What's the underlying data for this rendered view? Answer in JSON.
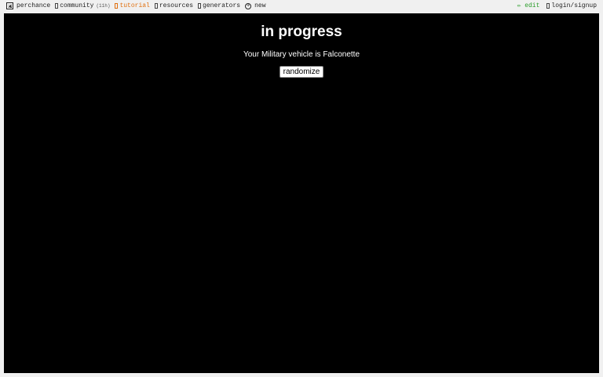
{
  "nav": {
    "left": [
      {
        "id": "perchance",
        "label": "perchance",
        "icon": "die-icon"
      },
      {
        "id": "community",
        "label": "community",
        "badge": "(11h)",
        "icon": "chat-icon"
      },
      {
        "id": "tutorial",
        "label": "tutorial",
        "icon": "book-icon",
        "color": "#e07010"
      },
      {
        "id": "resources",
        "label": "resources",
        "icon": "book-icon"
      },
      {
        "id": "generators",
        "label": "generators",
        "icon": "list-icon"
      },
      {
        "id": "new",
        "label": "new",
        "icon": "plus-circle-icon"
      }
    ],
    "right": [
      {
        "id": "edit",
        "label": "edit",
        "prefix": "✏",
        "icon": "pencil-icon",
        "color": "#2c9e2c"
      },
      {
        "id": "login",
        "label": "login/signup",
        "icon": "user-icon"
      }
    ]
  },
  "main": {
    "title": "in progress",
    "result_text": "Your Military vehicle is Falconette",
    "button_label": "randomize"
  }
}
